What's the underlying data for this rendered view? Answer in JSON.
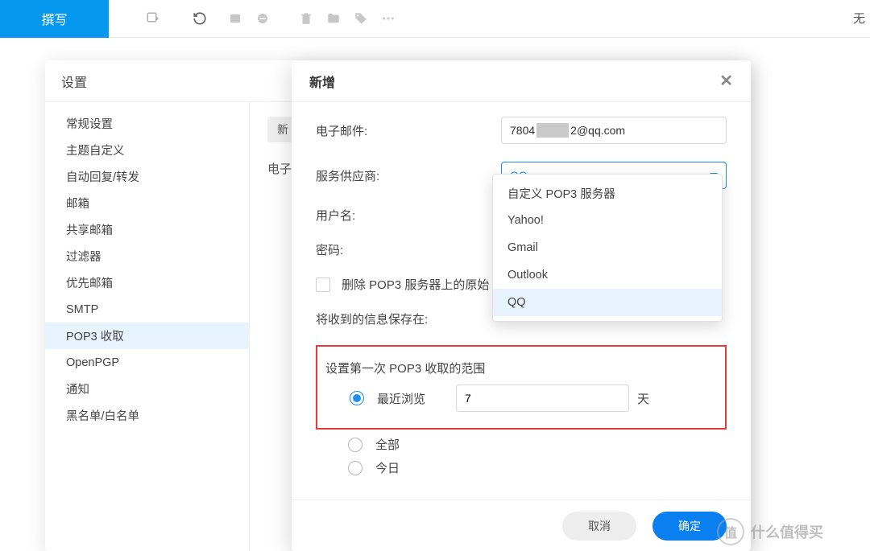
{
  "topbar": {
    "compose": "撰写",
    "right_text": "无"
  },
  "settings": {
    "title": "设置",
    "sidebar": [
      "常规设置",
      "主题自定义",
      "自动回复/转发",
      "邮箱",
      "共享邮箱",
      "过滤器",
      "优先邮箱",
      "SMTP",
      "POP3 收取",
      "OpenPGP",
      "通知",
      "黑名单/白名单"
    ],
    "active_index": 8,
    "content": {
      "tab_new": "新",
      "email_label": "电子"
    }
  },
  "modal": {
    "title": "新增",
    "labels": {
      "email": "电子邮件:",
      "provider": "服务供应商:",
      "username": "用户名:",
      "password": "密码:",
      "delete_original": "删除 POP3 服务器上的原始",
      "save_to": "将收到的信息保存在:",
      "scope_header": "设置第一次 POP3 收取的范围",
      "recent": "最近浏览",
      "all": "全部",
      "today": "今日",
      "days_suffix": "天"
    },
    "values": {
      "email_prefix": "7804",
      "email_suffix": "2@qq.com",
      "provider_selected": "QQ",
      "days": "7"
    },
    "buttons": {
      "cancel": "取消",
      "ok": "确定"
    }
  },
  "dropdown": {
    "options": [
      "自定义 POP3 服务器",
      "Yahoo!",
      "Gmail",
      "Outlook",
      "QQ"
    ],
    "selected_index": 4
  },
  "watermark": {
    "text": "什么值得买",
    "mark": "值"
  }
}
